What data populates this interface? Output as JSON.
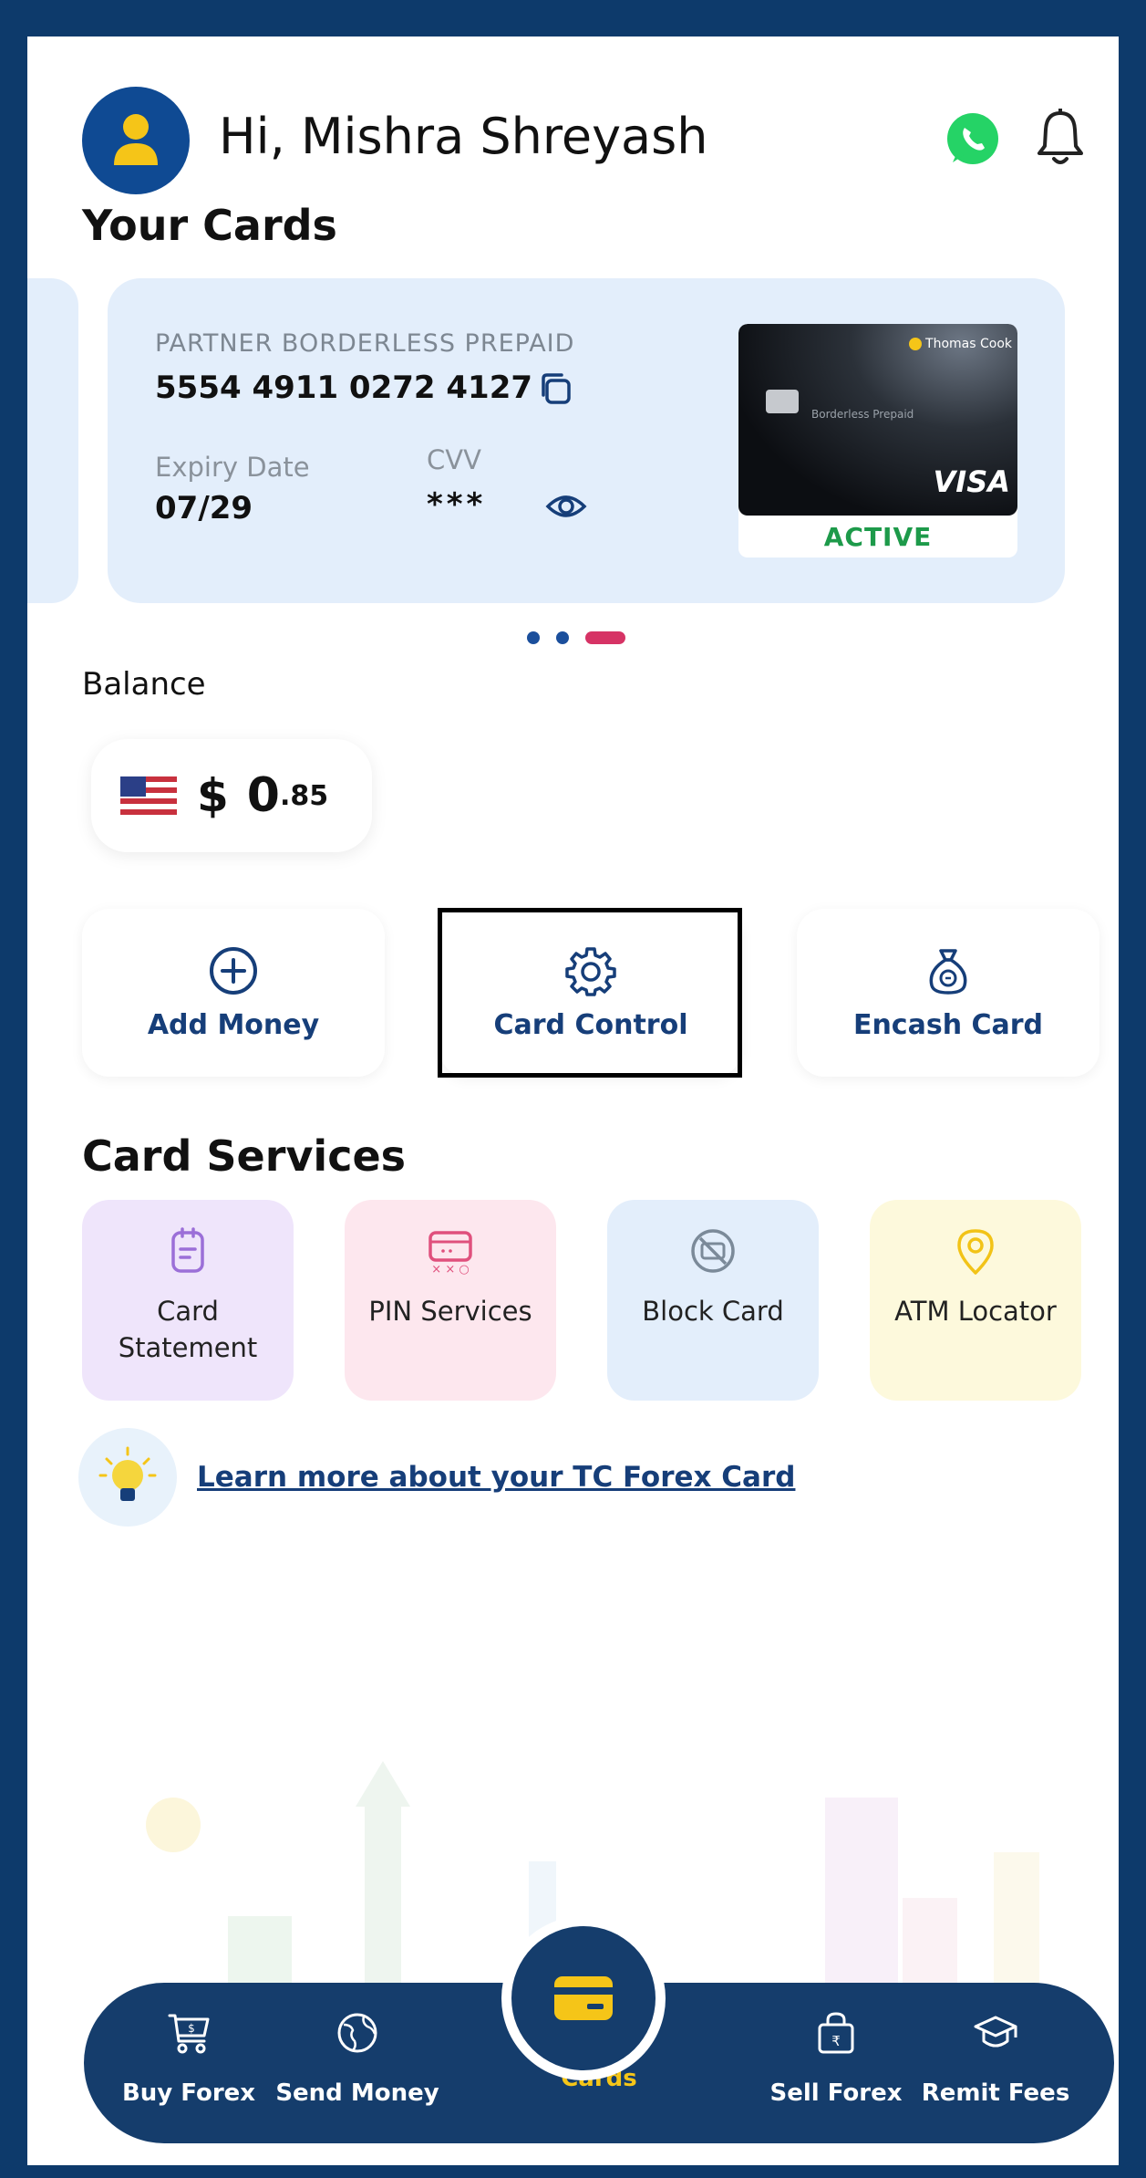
{
  "header": {
    "greeting": "Hi, Mishra Shreyash"
  },
  "cards_section": {
    "title": "Your Cards",
    "card": {
      "type": "PARTNER BORDERLESS PREPAID",
      "number": "5554 4911 0272 4127",
      "expiry_label": "Expiry Date",
      "expiry_value": "07/29",
      "cvv_label": "CVV",
      "cvv_value": "***",
      "brand_text": "Thomas Cook",
      "card_text": "Borderless Prepaid",
      "network": "VISA",
      "status": "ACTIVE"
    },
    "carousel": {
      "count": 3,
      "active_index": 2
    }
  },
  "balance": {
    "label": "Balance",
    "currency_symbol": "$",
    "amount_main": "0",
    "amount_fraction": ".85"
  },
  "actions": [
    {
      "label": "Add Money",
      "icon": "plus-circle-icon"
    },
    {
      "label": "Card Control",
      "icon": "gear-icon"
    },
    {
      "label": "Encash Card",
      "icon": "money-bag-icon"
    }
  ],
  "services": {
    "title": "Card Services",
    "items": [
      {
        "label": "Card Statement",
        "icon": "statement-icon",
        "bg": "#efe5fb",
        "accent": "#9b6fd8"
      },
      {
        "label": "PIN Services",
        "icon": "pin-card-icon",
        "bg": "#fde7ee",
        "accent": "#e0507d"
      },
      {
        "label": "Block Card",
        "icon": "block-card-icon",
        "bg": "#e3eefb",
        "accent": "#7b8a99"
      },
      {
        "label": "ATM Locator",
        "icon": "location-pin-icon",
        "bg": "#fdf9dc",
        "accent": "#f2c317"
      }
    ]
  },
  "learn_more": {
    "text": "Learn more about your TC Forex Card"
  },
  "bottom_nav": {
    "items": [
      {
        "label": "Buy Forex",
        "icon": "cart-icon"
      },
      {
        "label": "Send Money",
        "icon": "globe-icon"
      },
      {
        "label": "Cards",
        "icon": "card-icon",
        "selected": true
      },
      {
        "label": "Sell Forex",
        "icon": "shopping-bag-rupee-icon"
      },
      {
        "label": "Remit Fees",
        "icon": "graduation-cap-icon"
      }
    ]
  },
  "colors": {
    "primary": "#153d6c",
    "accent_yellow": "#f5c518",
    "active_green": "#1d9a4a",
    "dot_active": "#d63365"
  }
}
